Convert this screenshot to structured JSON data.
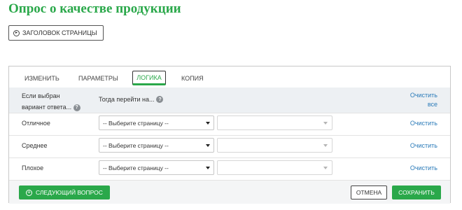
{
  "page": {
    "title": "Опрос о качестве продукции",
    "header_button_label": "ЗАГОЛОВОК СТРАНИЦЫ"
  },
  "tabs": [
    {
      "label": "ИЗМЕНИТЬ",
      "active": false
    },
    {
      "label": "ПАРАМЕТРЫ",
      "active": false
    },
    {
      "label": "ЛОГИКА",
      "active": true
    },
    {
      "label": "КОПИЯ",
      "active": false
    }
  ],
  "logic": {
    "header": {
      "if_selected_line1": "Если выбран",
      "if_selected_line2": "вариант ответа...",
      "then_go_to": "Тогда перейти на...",
      "clear_all_line1": "Очистить",
      "clear_all_line2": "все"
    },
    "rows": [
      {
        "answer": "Отличное",
        "page_select": "-- Выберите страницу --",
        "clear": "Очистить"
      },
      {
        "answer": "Среднее",
        "page_select": "-- Выберите страницу --",
        "clear": "Очистить"
      },
      {
        "answer": "Плохое",
        "page_select": "-- Выберите страницу --",
        "clear": "Очистить"
      }
    ]
  },
  "footer": {
    "next_question": "СЛЕДУЮЩИЙ ВОПРОС",
    "cancel": "ОТМЕНА",
    "save": "СОХРАНИТЬ"
  },
  "colors": {
    "accent_green": "#2aa84a",
    "link_blue": "#2b7bb9",
    "header_bg": "#edf0f3"
  },
  "icons": {
    "header_button": "circle-arrow-icon",
    "help": "help-icon",
    "add": "plus-circle-icon",
    "dropdown": "chevron-down-icon"
  }
}
